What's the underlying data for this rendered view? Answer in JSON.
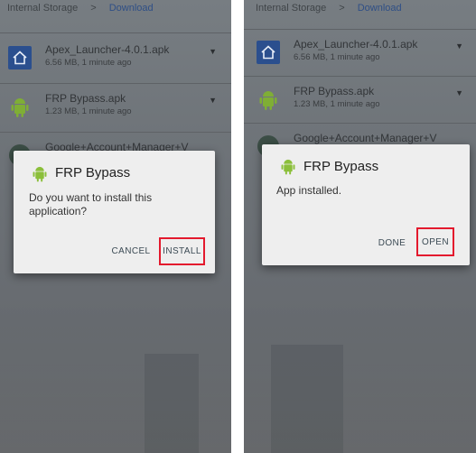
{
  "breadcrumb": {
    "root": "Internal Storage",
    "separator": ">",
    "current": "Download"
  },
  "files": [
    {
      "name": "Apex_Launcher-4.0.1.apk",
      "meta": "6.56 MB, 1 minute ago",
      "icon": "home-icon"
    },
    {
      "name": "FRP Bypass.apk",
      "meta": "1.23 MB, 1 minute ago",
      "icon": "android-icon"
    },
    {
      "name": "Google+Account+Manager+V",
      "icon": "apk-icon"
    }
  ],
  "install_dialog": {
    "title": "FRP Bypass",
    "message": "Do you want to install this application?",
    "cancel_label": "CANCEL",
    "install_label": "INSTALL"
  },
  "installed_dialog": {
    "title": "FRP Bypass",
    "message": "App installed.",
    "done_label": "DONE",
    "open_label": "OPEN"
  },
  "more_glyph": "▼",
  "colors": {
    "highlight": "#e3192d",
    "accent": "#2b4f8e",
    "android": "#8bbf3a"
  }
}
